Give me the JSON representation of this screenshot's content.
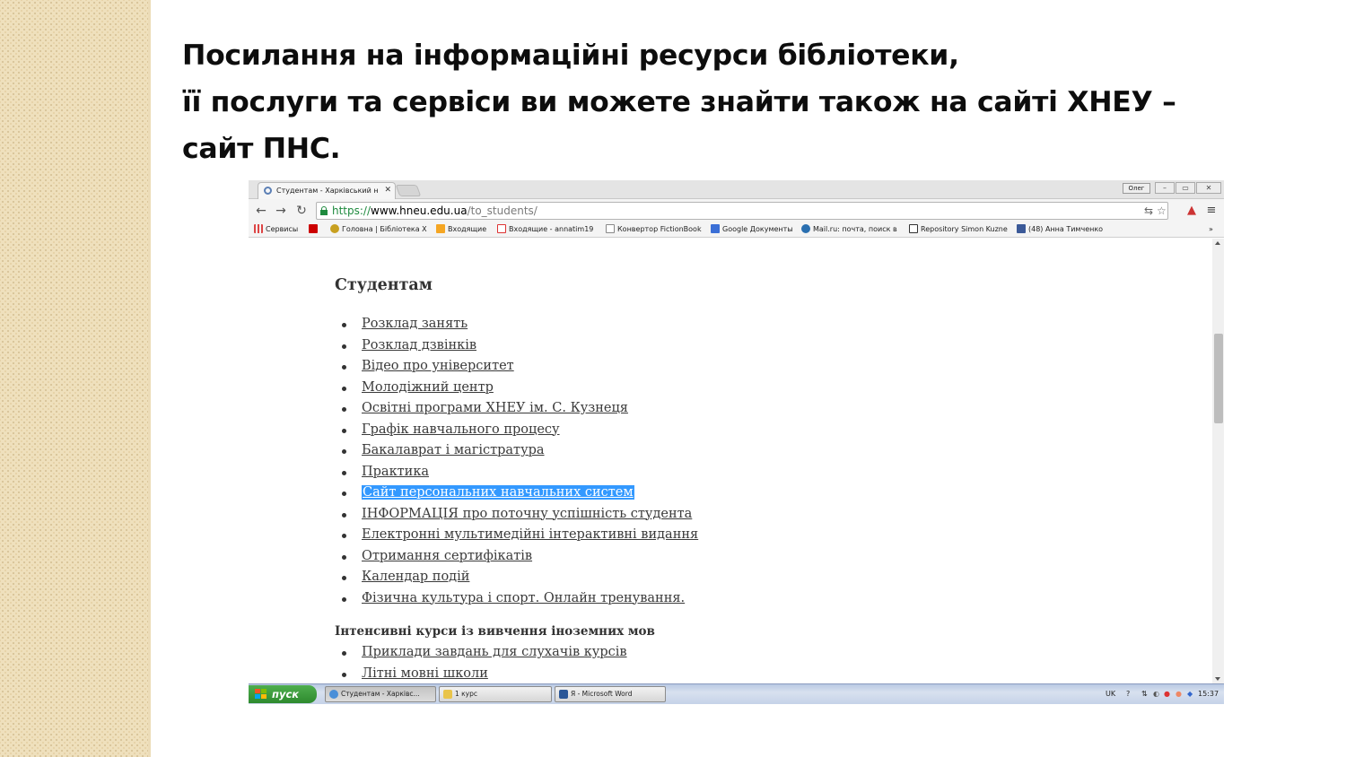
{
  "slide": {
    "title_lines": [
      "Посилання на інформаційні ресурси бібліотеки,",
      "її послуги та сервіси ви можете знайти також на сайті ХНЕУ –",
      "сайт ПНС."
    ]
  },
  "browser": {
    "tab_title": "Студентам - Харківський н",
    "tab_close": "✕",
    "user_button": "Олег",
    "window_buttons": [
      "–",
      "▭",
      "✕"
    ],
    "url_scheme": "https://",
    "url_host": "www.hneu.edu.ua",
    "url_path": "/to_students/",
    "bookmarks": [
      {
        "label": "Сервисы",
        "icon": "apps-grid-icon",
        "color": "#d44"
      },
      {
        "label": "",
        "icon": "bookmark-red-l-icon",
        "color": "#c00"
      },
      {
        "label": "Головна | Бібліотека Х",
        "icon": "owl-icon",
        "color": "#c8a020"
      },
      {
        "label": "Входящие",
        "icon": "mail-ru-icon",
        "color": "#f5a623"
      },
      {
        "label": "Входящие - annatim19",
        "icon": "gmail-icon",
        "color": "#d33"
      },
      {
        "label": "Конвертор FictionBook",
        "icon": "page-icon",
        "color": "#888"
      },
      {
        "label": "Google Документы",
        "icon": "google-docs-icon",
        "color": "#3b6fd6"
      },
      {
        "label": "Mail.ru: почта, поиск в",
        "icon": "mail-ru-at-icon",
        "color": "#2a6fb0"
      },
      {
        "label": "Repository Simon Kuzne",
        "icon": "repository-icon",
        "color": "#333"
      },
      {
        "label": "(48) Анна Тимченко",
        "icon": "facebook-icon",
        "color": "#3b5998"
      }
    ],
    "bookmarks_overflow": "»"
  },
  "page": {
    "heading": "Студентам",
    "links": [
      "Розклад занять",
      "Розклад дзвінків",
      "Відео про університет",
      "Молодіжний центр",
      "Освітні програми ХНЕУ ім. С. Кузнеця",
      "Графік навчального процесу",
      "Бакалаврат і магістратура",
      "Практика",
      "Сайт персональних навчальних систем",
      "ІНФОРМАЦІЯ про поточну успішність студента",
      "Електронні мультимедійні інтерактивні видання",
      "Отримання сертифікатів",
      "Календар подій",
      "Фізична культура і спорт. Онлайн тренування."
    ],
    "selected_link_index": 8,
    "subheading": "Інтенсивні курси із вивчення іноземних мов",
    "sublinks": [
      "Приклади завдань для слухачів курсів",
      "Літні мовні школи"
    ]
  },
  "taskbar": {
    "start_label": "пуск",
    "tasks": [
      {
        "label": "Студентам - Харківс...",
        "icon": "chrome-icon",
        "color": "#4a8fd8",
        "active": true
      },
      {
        "label": "1 курс",
        "icon": "folder-icon",
        "color": "#e9c44a",
        "active": false
      },
      {
        "label": "Я - Microsoft Word",
        "icon": "word-icon",
        "color": "#2b5797",
        "active": false
      }
    ],
    "tray_lang": "UK",
    "tray_clock": "15:37"
  },
  "colors": {
    "selection": "#3399ff",
    "accent_green": "#1e8a3e"
  }
}
